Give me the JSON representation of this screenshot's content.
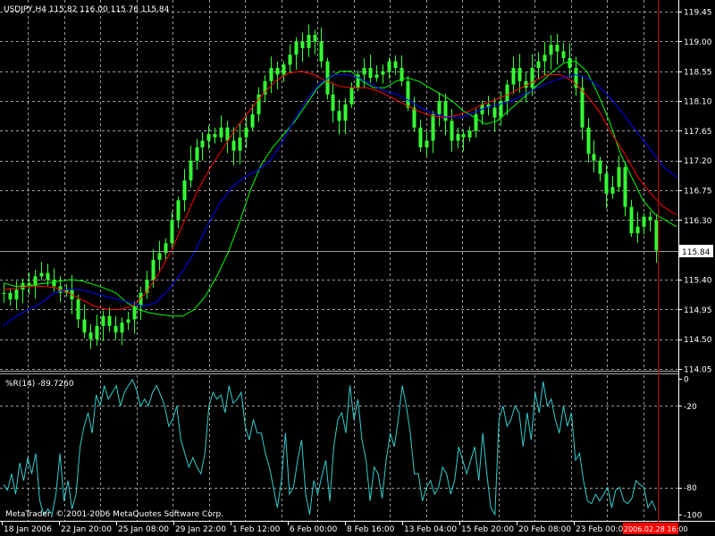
{
  "window": {
    "symbol_line": "USDJPY,H4  115.82 116.00 115.76 115.84",
    "indicator_line": "%R(14) -89.7260",
    "copyright": "MetaTrader, © 2001-2006 MetaQuotes Software Corp."
  },
  "colors": {
    "background": "#000000",
    "grid": "#9a9a9a",
    "candles": "#33ff33",
    "ma_fast": "#00ff00",
    "ma_mid": "#ff0000",
    "ma_slow": "#0000ff",
    "wpr": "#33cccc",
    "current_line": "#c00000",
    "price_tag_bg": "#ffffff",
    "time_tag_bg": "#ff0000"
  },
  "price_tag": "115.84",
  "current_time_tag": "2006.02.28 16:00",
  "chart_data": [
    {
      "type": "candlestick",
      "title": "USDJPY,H4",
      "ylim": [
        114.05,
        119.6
      ],
      "ytick_labels": [
        "119.45",
        "119.00",
        "118.55",
        "118.10",
        "117.65",
        "117.20",
        "116.75",
        "116.30",
        "115.84",
        "115.40",
        "114.95",
        "114.50",
        "114.05"
      ],
      "xtick_labels": [
        "18 Jan 2006",
        "22 Jan 20:00",
        "25 Jan 08:00",
        "29 Jan 22:00",
        "1 Feb 12:00",
        "6 Feb 00:00",
        "8 Feb 16:00",
        "13 Feb 04:00",
        "15 Feb 20:00",
        "20 Feb 08:00",
        "23 Feb 00:00"
      ],
      "close_series": [
        115.2,
        115.1,
        115.25,
        115.35,
        115.3,
        115.45,
        115.5,
        115.4,
        115.3,
        115.2,
        115.25,
        115.1,
        114.8,
        114.6,
        114.5,
        114.7,
        114.85,
        114.7,
        114.6,
        114.75,
        114.8,
        115.0,
        115.2,
        115.4,
        115.7,
        115.8,
        115.95,
        116.3,
        116.6,
        116.9,
        117.2,
        117.4,
        117.5,
        117.6,
        117.55,
        117.7,
        117.5,
        117.35,
        117.55,
        117.7,
        117.9,
        118.2,
        118.4,
        118.6,
        118.5,
        118.65,
        118.8,
        119.0,
        118.9,
        119.1,
        119.0,
        118.7,
        118.2,
        117.95,
        117.8,
        118.05,
        118.3,
        118.5,
        118.6,
        118.45,
        118.5,
        118.55,
        118.7,
        118.6,
        118.4,
        118.0,
        117.7,
        117.4,
        117.5,
        117.9,
        118.1,
        117.8,
        117.5,
        117.6,
        117.55,
        117.65,
        117.9,
        118.05,
        118.0,
        117.85,
        118.1,
        118.35,
        118.6,
        118.4,
        118.3,
        118.6,
        118.7,
        118.8,
        118.95,
        118.85,
        118.75,
        118.6,
        118.3,
        117.7,
        117.3,
        117.2,
        117.0,
        116.7,
        116.8,
        117.1,
        116.5,
        116.1,
        116.2,
        116.35,
        116.3,
        115.84
      ],
      "series": [
        {
          "name": "MA fast",
          "values": [
            115.35,
            115.3,
            115.3,
            115.33,
            115.35,
            115.38,
            115.4,
            115.38,
            115.33,
            115.27,
            115.2,
            115.05,
            114.95,
            114.9,
            114.87,
            114.85,
            114.85,
            114.95,
            115.15,
            115.45,
            115.8,
            116.25,
            116.75,
            117.15,
            117.4,
            117.6,
            117.8,
            118.05,
            118.3,
            118.45,
            118.55,
            118.55,
            118.4,
            118.3,
            118.3,
            118.4,
            118.45,
            118.4,
            118.3,
            118.2,
            118.1,
            117.95,
            117.85,
            117.75,
            117.8,
            117.95,
            118.1,
            118.25,
            118.4,
            118.55,
            118.68,
            118.7,
            118.55,
            118.2,
            117.8,
            117.3,
            116.95,
            116.6,
            116.4,
            116.3,
            116.2
          ]
        },
        {
          "name": "MA mid",
          "values": [
            115.25,
            115.27,
            115.3,
            115.3,
            115.28,
            115.2,
            115.1,
            115.0,
            114.95,
            114.95,
            115.0,
            115.2,
            115.5,
            115.85,
            116.3,
            116.75,
            117.1,
            117.4,
            117.7,
            117.95,
            118.2,
            118.4,
            118.52,
            118.55,
            118.5,
            118.4,
            118.32,
            118.3,
            118.3,
            118.25,
            118.15,
            118.05,
            117.95,
            117.88,
            117.85,
            117.88,
            117.95,
            118.05,
            118.12,
            118.2,
            118.3,
            118.4,
            118.5,
            118.5,
            118.4,
            118.2,
            117.95,
            117.6,
            117.3,
            116.95,
            116.7,
            116.5,
            116.38
          ]
        },
        {
          "name": "MA slow",
          "values": [
            114.7,
            114.85,
            114.95,
            115.05,
            115.2,
            115.25,
            115.25,
            115.2,
            115.15,
            115.1,
            115.05,
            115.0,
            115.05,
            115.25,
            115.5,
            115.8,
            116.2,
            116.55,
            116.8,
            116.95,
            117.05,
            117.2,
            117.5,
            117.85,
            118.15,
            118.38,
            118.5,
            118.5,
            118.45,
            118.35,
            118.25,
            118.2,
            118.1,
            117.98,
            117.9,
            117.85,
            117.85,
            117.92,
            118.0,
            118.05,
            118.1,
            118.2,
            118.3,
            118.38,
            118.45,
            118.5,
            118.45,
            118.3,
            118.1,
            117.85,
            117.6,
            117.35,
            117.1,
            116.95
          ]
        }
      ]
    },
    {
      "type": "line",
      "title": "%R(14) -89.7260",
      "ylim": [
        -100,
        0
      ],
      "ytick_labels": [
        "0",
        "-20",
        "-80",
        "-100"
      ],
      "series": [
        {
          "name": "%R(14)",
          "values": [
            -78,
            -82,
            -70,
            -85,
            -62,
            -75,
            -58,
            -70,
            -55,
            -90,
            -100,
            -96,
            -100,
            -85,
            -55,
            -90,
            -75,
            -96,
            -85,
            -50,
            -35,
            -25,
            -40,
            -12,
            -20,
            -5,
            -15,
            -10,
            -5,
            -20,
            -10,
            -5,
            -0.5,
            -8,
            -20,
            -15,
            -20,
            -10,
            -5,
            -12,
            -20,
            -35,
            -30,
            -20,
            -45,
            -55,
            -65,
            -58,
            -65,
            -70,
            -55,
            -20,
            -10,
            -15,
            -12,
            -25,
            -5,
            -18,
            -15,
            -10,
            -35,
            -45,
            -30,
            -40,
            -40,
            -55,
            -65,
            -80,
            -95,
            -75,
            -40,
            -85,
            -80,
            -60,
            -45,
            -85,
            -100,
            -75,
            -85,
            -72,
            -60,
            -90,
            -50,
            -30,
            -25,
            -40,
            -5,
            -30,
            -15,
            -45,
            -60,
            -90,
            -65,
            -70,
            -88,
            -60,
            -40,
            -50,
            -30,
            -5,
            -20,
            -40,
            -70,
            -70,
            -90,
            -80,
            -75,
            -85,
            -80,
            -65,
            -70,
            -85,
            -75,
            -50,
            -60,
            -70,
            -60,
            -50,
            -75,
            -40,
            -70,
            -95,
            -100,
            -30,
            -20,
            -35,
            -30,
            -20,
            -25,
            -50,
            -25,
            -45,
            -10,
            -25,
            -2,
            -20,
            -15,
            -30,
            -40,
            -20,
            -35,
            -25,
            -60,
            -55,
            -75,
            -90,
            -92,
            -85,
            -90,
            -85,
            -80,
            -95,
            -82,
            -80,
            -90,
            -92,
            -88,
            -75,
            -78,
            -80,
            -95,
            -90,
            -97
          ]
        }
      ]
    }
  ]
}
